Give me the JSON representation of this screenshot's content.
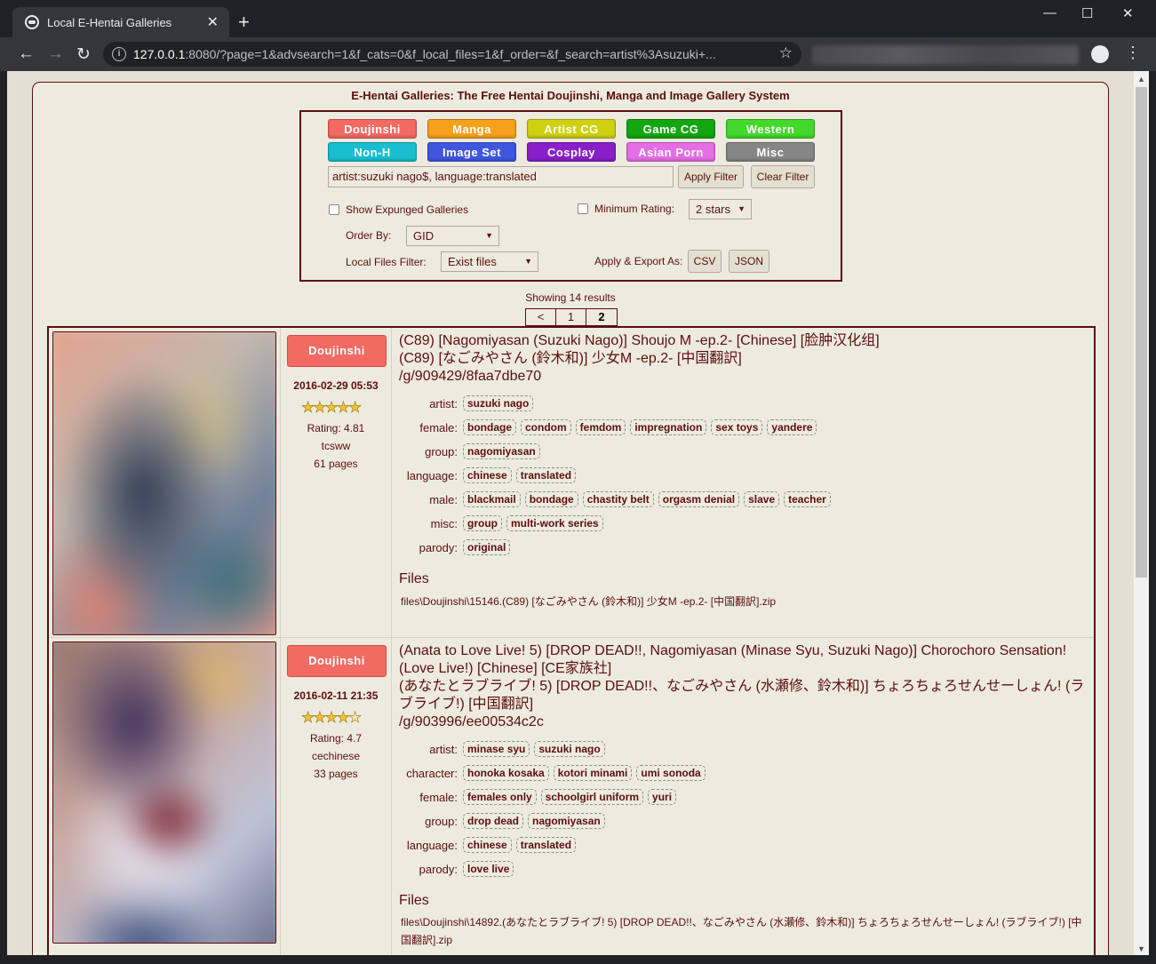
{
  "browser": {
    "tab_title": "Local E-Hentai Galleries",
    "url_host": "127.0.0.1",
    "url_rest": ":8080/?page=1&advsearch=1&f_cats=0&f_local_files=1&f_order=&f_search=artist%3Asuzuki+..."
  },
  "page": {
    "title": "E-Hentai Galleries: The Free Hentai Doujinshi, Manga and Image Gallery System",
    "categories": [
      {
        "label": "Doujinshi",
        "color": "#f36a63"
      },
      {
        "label": "Manga",
        "color": "#f5a11c"
      },
      {
        "label": "Artist CG",
        "color": "#d0d10e"
      },
      {
        "label": "Game CG",
        "color": "#13a610"
      },
      {
        "label": "Western",
        "color": "#43d92a"
      },
      {
        "label": "Non-H",
        "color": "#19bfd1"
      },
      {
        "label": "Image Set",
        "color": "#3f56e0"
      },
      {
        "label": "Cosplay",
        "color": "#8a1ec9"
      },
      {
        "label": "Asian Porn",
        "color": "#e66de6"
      },
      {
        "label": "Misc",
        "color": "#868686"
      }
    ],
    "search_value": "artist:suzuki nago$, language:translated",
    "apply_filter": "Apply Filter",
    "clear_filter": "Clear Filter",
    "show_expunged": "Show Expunged Galleries",
    "min_rating_label": "Minimum Rating:",
    "min_rating_value": "2 stars",
    "order_by_label": "Order By:",
    "order_by_value": "GID",
    "local_files_label": "Local Files Filter:",
    "local_files_value": "Exist files",
    "export_label": "Apply & Export As:",
    "export_csv": "CSV",
    "export_json": "JSON",
    "results": "Showing 14 results",
    "pager": [
      "<",
      "1",
      "2"
    ]
  },
  "galleries": [
    {
      "category": "Doujinshi",
      "date": "2016-02-29 05:53",
      "rating_text": "Rating: 4.81",
      "rating_value": 4.81,
      "uploader": "tcsww",
      "pages": "61 pages",
      "title_en": "(C89) [Nagomiyasan (Suzuki Nago)] Shoujo M -ep.2- [Chinese] [脸肿汉化组]",
      "title_jp": "(C89) [なごみやさん (鈴木和)] 少女M -ep.2- [中国翻訳]",
      "gid": "/g/909429/8faa7dbe70",
      "tags": [
        {
          "ns": "artist:",
          "items": [
            "suzuki nago"
          ]
        },
        {
          "ns": "female:",
          "items": [
            "bondage",
            "condom",
            "femdom",
            "impregnation",
            "sex toys",
            "yandere"
          ]
        },
        {
          "ns": "group:",
          "items": [
            "nagomiyasan"
          ]
        },
        {
          "ns": "language:",
          "items": [
            "chinese",
            "translated"
          ]
        },
        {
          "ns": "male:",
          "items": [
            "blackmail",
            "bondage",
            "chastity belt",
            "orgasm denial",
            "slave",
            "teacher"
          ]
        },
        {
          "ns": "misc:",
          "items": [
            "group",
            "multi-work series"
          ]
        },
        {
          "ns": "parody:",
          "items": [
            "original"
          ]
        }
      ],
      "files_heading": "Files",
      "file_path": "files\\Doujinshi\\15146.(C89) [なごみやさん (鈴木和)] 少女M -ep.2- [中国翻訳].zip"
    },
    {
      "category": "Doujinshi",
      "date": "2016-02-11 21:35",
      "rating_text": "Rating: 4.7",
      "rating_value": 4.7,
      "uploader": "cechinese",
      "pages": "33 pages",
      "title_en": "(Anata to Love Live! 5) [DROP DEAD!!, Nagomiyasan (Minase Syu, Suzuki Nago)] Chorochoro Sensation! (Love Live!) [Chinese] [CE家族社]",
      "title_jp": "(あなたとラブライブ! 5) [DROP DEAD!!、なごみやさん (水瀬修、鈴木和)] ちょろちょろせんせーしょん! (ラブライブ!) [中国翻訳]",
      "gid": "/g/903996/ee00534c2c",
      "tags": [
        {
          "ns": "artist:",
          "items": [
            "minase syu",
            "suzuki nago"
          ]
        },
        {
          "ns": "character:",
          "items": [
            "honoka kosaka",
            "kotori minami",
            "umi sonoda"
          ]
        },
        {
          "ns": "female:",
          "items": [
            "females only",
            "schoolgirl uniform",
            "yuri"
          ]
        },
        {
          "ns": "group:",
          "items": [
            "drop dead",
            "nagomiyasan"
          ]
        },
        {
          "ns": "language:",
          "items": [
            "chinese",
            "translated"
          ]
        },
        {
          "ns": "parody:",
          "items": [
            "love live"
          ]
        }
      ],
      "files_heading": "Files",
      "file_path": "files\\Doujinshi\\14892.(あなたとラブライブ! 5) [DROP DEAD!!、なごみやさん (水瀬修、鈴木和)] ちょろちょろせんせーしょん! (ラブライブ!) [中国翻訳].zip"
    }
  ]
}
